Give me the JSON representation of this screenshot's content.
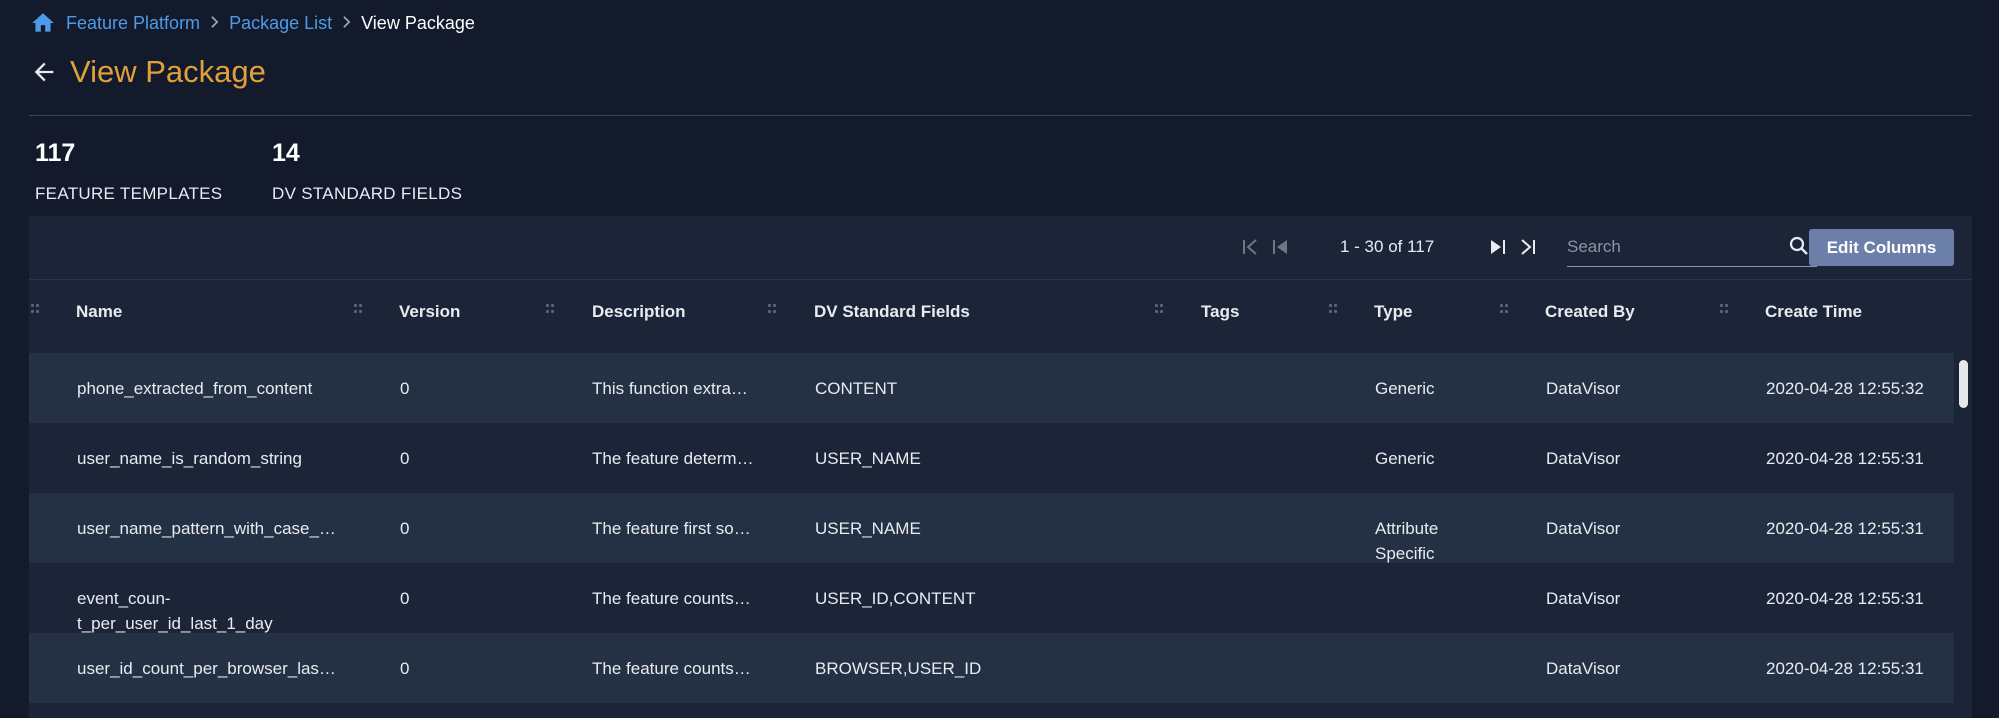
{
  "breadcrumb": {
    "home_icon": "home-icon",
    "items": [
      "Feature Platform",
      "Package List",
      "View Package"
    ]
  },
  "page": {
    "title": "View Package"
  },
  "stats": [
    {
      "value": "117",
      "label": "FEATURE TEMPLATES"
    },
    {
      "value": "14",
      "label": "DV STANDARD FIELDS"
    }
  ],
  "pagination": {
    "text": "1 - 30 of 117"
  },
  "search": {
    "placeholder": "Search",
    "value": ""
  },
  "toolbar": {
    "edit_columns_label": "Edit Columns"
  },
  "table": {
    "columns": [
      "Name",
      "Version",
      "Description",
      "DV Standard Fields",
      "Tags",
      "Type",
      "Created By",
      "Create Time"
    ],
    "rows": [
      {
        "name": "phone_extracted_from_content",
        "version": "0",
        "description": "This function extra…",
        "fields": "CONTENT",
        "tags": "",
        "type": "Generic",
        "created_by": "DataVisor",
        "create_time": "2020-04-28 12:55:32"
      },
      {
        "name": "user_name_is_random_string",
        "version": "0",
        "description": "The feature determ…",
        "fields": "USER_NAME",
        "tags": "",
        "type": "Generic",
        "created_by": "DataVisor",
        "create_time": "2020-04-28 12:55:31"
      },
      {
        "name": "user_name_pattern_with_case_…",
        "version": "0",
        "description": "The feature first so…",
        "fields": "USER_NAME",
        "tags": "",
        "type": "Attribute Specific",
        "created_by": "DataVisor",
        "create_time": "2020-04-28 12:55:31"
      },
      {
        "name": "event_coun-t_per_user_id_last_1_day",
        "version": "0",
        "description": "The feature counts…",
        "fields": "USER_ID,CONTENT",
        "tags": "",
        "type": "",
        "created_by": "DataVisor",
        "create_time": "2020-04-28 12:55:31"
      },
      {
        "name": "user_id_count_per_browser_las…",
        "version": "0",
        "description": "The feature counts…",
        "fields": "BROWSER,USER_ID",
        "tags": "",
        "type": "",
        "created_by": "DataVisor",
        "create_time": "2020-04-28 12:55:31"
      }
    ]
  },
  "colors": {
    "background": "#121a2b",
    "panel": "#1c2537",
    "row_alt": "#243043",
    "accent_title": "#e0a13a",
    "link": "#4d9be8",
    "button": "#6b7fa8"
  }
}
